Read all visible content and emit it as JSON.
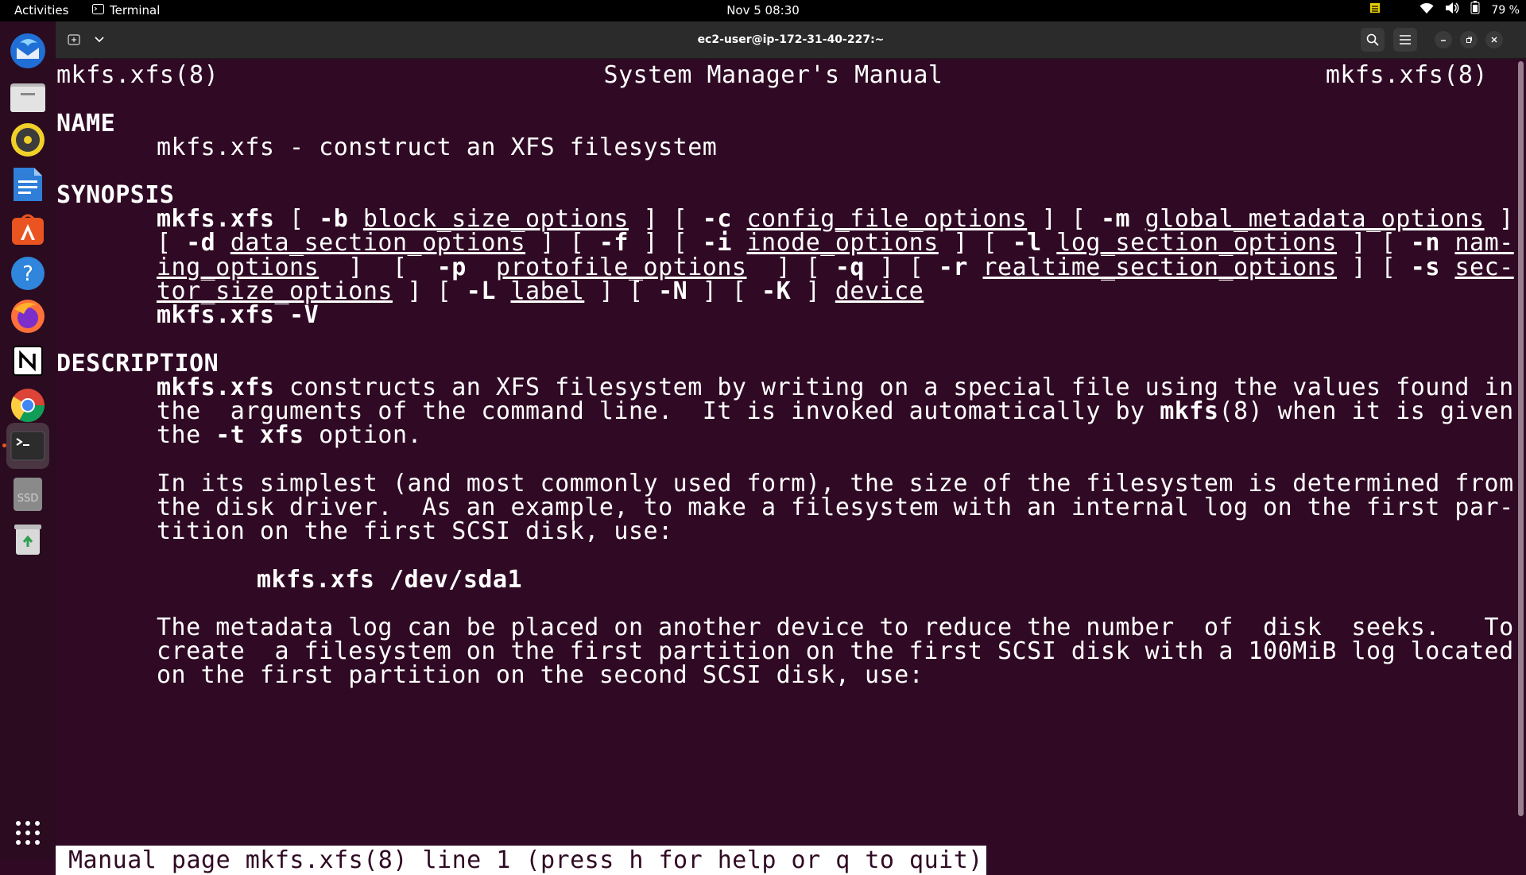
{
  "topbar": {
    "activities": "Activities",
    "app_name": "Terminal",
    "clock": "Nov 5  08:30",
    "battery": "79 %"
  },
  "dock": {
    "items": [
      "thunderbird",
      "files",
      "rhythmbox",
      "writer",
      "software",
      "help",
      "firefox",
      "notion",
      "chrome",
      "terminal",
      "ssd",
      "trash",
      "app-grid"
    ],
    "ssd_label": "SSD"
  },
  "window": {
    "title": "ec2-user@ip-172-31-40-227:~"
  },
  "man": {
    "header_left": "mkfs.xfs(8)",
    "header_center": "System Manager's Manual",
    "header_right": "mkfs.xfs(8)",
    "name_heading": "NAME",
    "name_text": "mkfs.xfs - construct an XFS filesystem",
    "synopsis_heading": "SYNOPSIS",
    "description_heading": "DESCRIPTION",
    "example_command": "mkfs.xfs /dev/sda1",
    "status_line": "Manual page mkfs.xfs(8) line 1 (press h for help or q to quit)"
  },
  "synopsis_lines": [
    [
      [
        "b",
        "mkfs.xfs"
      ],
      [
        "n",
        " [ "
      ],
      [
        "b",
        "-b"
      ],
      [
        "n",
        " "
      ],
      [
        "u",
        "block_size_options"
      ],
      [
        "n",
        " ] [ "
      ],
      [
        "b",
        "-c"
      ],
      [
        "n",
        " "
      ],
      [
        "u",
        "config_file_options"
      ],
      [
        "n",
        " ] [ "
      ],
      [
        "b",
        "-m"
      ],
      [
        "n",
        " "
      ],
      [
        "u",
        "global_metadata_options"
      ],
      [
        "n",
        " ]"
      ]
    ],
    [
      [
        "n",
        "[ "
      ],
      [
        "b",
        "-d"
      ],
      [
        "n",
        " "
      ],
      [
        "u",
        "data_section_options"
      ],
      [
        "n",
        " ] [ "
      ],
      [
        "b",
        "-f"
      ],
      [
        "n",
        " ] [ "
      ],
      [
        "b",
        "-i"
      ],
      [
        "n",
        " "
      ],
      [
        "u",
        "inode_options"
      ],
      [
        "n",
        " ] [ "
      ],
      [
        "b",
        "-l"
      ],
      [
        "n",
        " "
      ],
      [
        "u",
        "log_section_options"
      ],
      [
        "n",
        " ] [ "
      ],
      [
        "b",
        "-n"
      ],
      [
        "n",
        " "
      ],
      [
        "u",
        "nam-"
      ]
    ],
    [
      [
        "u",
        "ing_options"
      ],
      [
        "n",
        "  ]  [  "
      ],
      [
        "b",
        "-p"
      ],
      [
        "n",
        "  "
      ],
      [
        "u",
        "protofile_options"
      ],
      [
        "n",
        "  ] [ "
      ],
      [
        "b",
        "-q"
      ],
      [
        "n",
        " ] [ "
      ],
      [
        "b",
        "-r"
      ],
      [
        "n",
        " "
      ],
      [
        "u",
        "realtime_section_options"
      ],
      [
        "n",
        " ] [ "
      ],
      [
        "b",
        "-s"
      ],
      [
        "n",
        " "
      ],
      [
        "u",
        "sec-"
      ]
    ],
    [
      [
        "u",
        "tor_size_options"
      ],
      [
        "n",
        " ] [ "
      ],
      [
        "b",
        "-L"
      ],
      [
        "n",
        " "
      ],
      [
        "u",
        "label"
      ],
      [
        "n",
        " ] [ "
      ],
      [
        "b",
        "-N"
      ],
      [
        "n",
        " ] [ "
      ],
      [
        "b",
        "-K"
      ],
      [
        "n",
        " ] "
      ],
      [
        "u",
        "device"
      ]
    ],
    [
      [
        "b",
        "mkfs.xfs -V"
      ]
    ]
  ],
  "description_lines": [
    [
      [
        "b",
        "mkfs.xfs"
      ],
      [
        "n",
        " constructs an XFS filesystem by writing on a special file using the values found in"
      ]
    ],
    [
      [
        "n",
        "the  arguments of the command line.  It is invoked automatically by "
      ],
      [
        "b",
        "mkfs"
      ],
      [
        "n",
        "(8) when it is given"
      ]
    ],
    [
      [
        "n",
        "the "
      ],
      [
        "b",
        "-t xfs"
      ],
      [
        "n",
        " option."
      ]
    ],
    [
      [
        "n",
        "In its simplest (and most commonly used form), the size of the filesystem is determined from"
      ]
    ],
    [
      [
        "n",
        "the disk driver.  As an example, to make a filesystem with an internal log on the first par-"
      ]
    ],
    [
      [
        "n",
        "tition on the first SCSI disk, use:"
      ]
    ],
    [
      [
        "n",
        "The metadata log can be placed on another device to reduce the number  of  disk  seeks.   To"
      ]
    ],
    [
      [
        "n",
        "create  a filesystem on the first partition on the first SCSI disk with a 100MiB log located"
      ]
    ],
    [
      [
        "n",
        "on the first partition on the second SCSI disk, use:"
      ]
    ]
  ]
}
